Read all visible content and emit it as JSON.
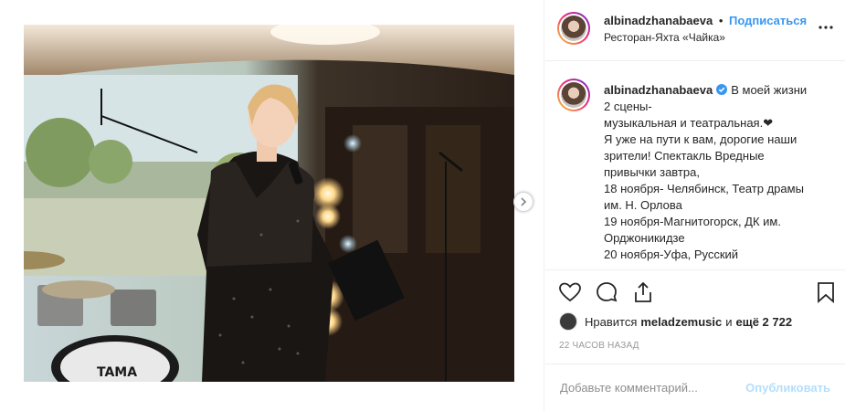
{
  "post": {
    "username": "albinadzhanabaeva",
    "follow_label": "Подписаться",
    "separator": "•",
    "location": "Ресторан-Яхта «Чайка»"
  },
  "caption": {
    "username": "albinadzhanabaeva",
    "lines": [
      "В моей жизни",
      "2 сцены-",
      "музыкальная и театральная.❤",
      "Я уже на пути к вам, дорогие наши",
      "зрители! Спектакль Вредные",
      "привычки завтра,",
      "18 ноября- Челябинск, Театр драмы",
      "им. Н. Орлова",
      "19 ноября-Магнитогорск, ДК им.",
      "Орджоникидзе",
      "20 ноября-Уфа, Русский"
    ]
  },
  "likes": {
    "prefix": "Нравится",
    "user": "meladzemusic",
    "conjunction": "и",
    "others": "ещё 2 722"
  },
  "timestamp": "22 часов назад",
  "comment": {
    "placeholder": "Добавьте комментарий...",
    "publish_label": "Опубликовать"
  },
  "photo": {
    "drum_brand": "TAMA"
  },
  "colors": {
    "link": "#3897f0",
    "publish_disabled": "#b2dffc",
    "verified": "#3897f0"
  }
}
